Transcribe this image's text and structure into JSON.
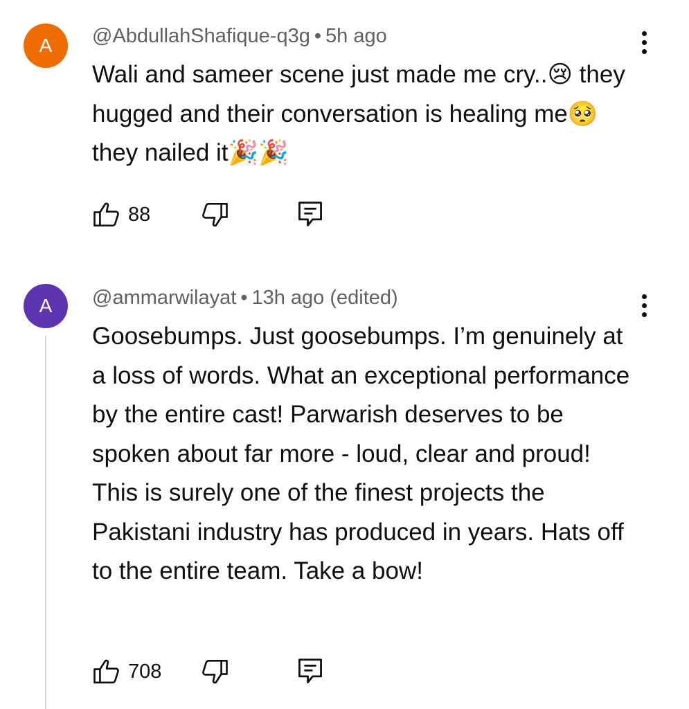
{
  "comments": [
    {
      "avatar_letter": "A",
      "avatar_color": "#ef6c00",
      "author": "@AbdullahShafique-q3g",
      "separator": "•",
      "time": "5h ago",
      "text": "Wali and sameer scene just made me cry..😢 they hugged and their conversation is healing me🥺they nailed it🎉🎉",
      "likes": "88"
    },
    {
      "avatar_letter": "A",
      "avatar_color": "#5e35b1",
      "author": "@ammarwilayat",
      "separator": "•",
      "time": "13h ago (edited)",
      "text": "Goosebumps. Just goosebumps. I’m genuinely at a loss of words. What an exceptional performance by the entire cast! Parwarish deserves to be spoken about far more - loud, clear and proud! This is surely one of the finest projects the Pakistani industry has produced in years. Hats off to the entire team. Take a bow!",
      "likes": "708"
    }
  ],
  "icons": {
    "like": "thumbs-up-icon",
    "dislike": "thumbs-down-icon",
    "reply": "reply-comment-icon",
    "more": "more-vert-icon"
  }
}
